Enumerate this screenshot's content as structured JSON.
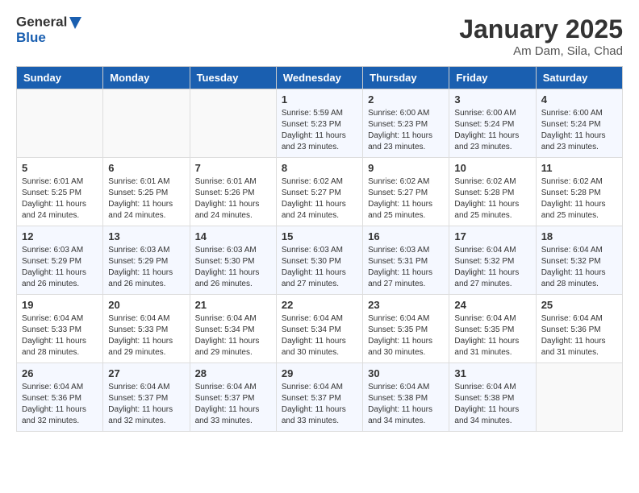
{
  "header": {
    "logo": {
      "text_general": "General",
      "text_blue": "Blue"
    },
    "title": "January 2025",
    "location": "Am Dam, Sila, Chad"
  },
  "weekdays": [
    "Sunday",
    "Monday",
    "Tuesday",
    "Wednesday",
    "Thursday",
    "Friday",
    "Saturday"
  ],
  "weeks": [
    [
      {
        "day": "",
        "info": ""
      },
      {
        "day": "",
        "info": ""
      },
      {
        "day": "",
        "info": ""
      },
      {
        "day": "1",
        "info": "Sunrise: 5:59 AM\nSunset: 5:23 PM\nDaylight: 11 hours\nand 23 minutes."
      },
      {
        "day": "2",
        "info": "Sunrise: 6:00 AM\nSunset: 5:23 PM\nDaylight: 11 hours\nand 23 minutes."
      },
      {
        "day": "3",
        "info": "Sunrise: 6:00 AM\nSunset: 5:24 PM\nDaylight: 11 hours\nand 23 minutes."
      },
      {
        "day": "4",
        "info": "Sunrise: 6:00 AM\nSunset: 5:24 PM\nDaylight: 11 hours\nand 23 minutes."
      }
    ],
    [
      {
        "day": "5",
        "info": "Sunrise: 6:01 AM\nSunset: 5:25 PM\nDaylight: 11 hours\nand 24 minutes."
      },
      {
        "day": "6",
        "info": "Sunrise: 6:01 AM\nSunset: 5:25 PM\nDaylight: 11 hours\nand 24 minutes."
      },
      {
        "day": "7",
        "info": "Sunrise: 6:01 AM\nSunset: 5:26 PM\nDaylight: 11 hours\nand 24 minutes."
      },
      {
        "day": "8",
        "info": "Sunrise: 6:02 AM\nSunset: 5:27 PM\nDaylight: 11 hours\nand 24 minutes."
      },
      {
        "day": "9",
        "info": "Sunrise: 6:02 AM\nSunset: 5:27 PM\nDaylight: 11 hours\nand 25 minutes."
      },
      {
        "day": "10",
        "info": "Sunrise: 6:02 AM\nSunset: 5:28 PM\nDaylight: 11 hours\nand 25 minutes."
      },
      {
        "day": "11",
        "info": "Sunrise: 6:02 AM\nSunset: 5:28 PM\nDaylight: 11 hours\nand 25 minutes."
      }
    ],
    [
      {
        "day": "12",
        "info": "Sunrise: 6:03 AM\nSunset: 5:29 PM\nDaylight: 11 hours\nand 26 minutes."
      },
      {
        "day": "13",
        "info": "Sunrise: 6:03 AM\nSunset: 5:29 PM\nDaylight: 11 hours\nand 26 minutes."
      },
      {
        "day": "14",
        "info": "Sunrise: 6:03 AM\nSunset: 5:30 PM\nDaylight: 11 hours\nand 26 minutes."
      },
      {
        "day": "15",
        "info": "Sunrise: 6:03 AM\nSunset: 5:30 PM\nDaylight: 11 hours\nand 27 minutes."
      },
      {
        "day": "16",
        "info": "Sunrise: 6:03 AM\nSunset: 5:31 PM\nDaylight: 11 hours\nand 27 minutes."
      },
      {
        "day": "17",
        "info": "Sunrise: 6:04 AM\nSunset: 5:32 PM\nDaylight: 11 hours\nand 27 minutes."
      },
      {
        "day": "18",
        "info": "Sunrise: 6:04 AM\nSunset: 5:32 PM\nDaylight: 11 hours\nand 28 minutes."
      }
    ],
    [
      {
        "day": "19",
        "info": "Sunrise: 6:04 AM\nSunset: 5:33 PM\nDaylight: 11 hours\nand 28 minutes."
      },
      {
        "day": "20",
        "info": "Sunrise: 6:04 AM\nSunset: 5:33 PM\nDaylight: 11 hours\nand 29 minutes."
      },
      {
        "day": "21",
        "info": "Sunrise: 6:04 AM\nSunset: 5:34 PM\nDaylight: 11 hours\nand 29 minutes."
      },
      {
        "day": "22",
        "info": "Sunrise: 6:04 AM\nSunset: 5:34 PM\nDaylight: 11 hours\nand 30 minutes."
      },
      {
        "day": "23",
        "info": "Sunrise: 6:04 AM\nSunset: 5:35 PM\nDaylight: 11 hours\nand 30 minutes."
      },
      {
        "day": "24",
        "info": "Sunrise: 6:04 AM\nSunset: 5:35 PM\nDaylight: 11 hours\nand 31 minutes."
      },
      {
        "day": "25",
        "info": "Sunrise: 6:04 AM\nSunset: 5:36 PM\nDaylight: 11 hours\nand 31 minutes."
      }
    ],
    [
      {
        "day": "26",
        "info": "Sunrise: 6:04 AM\nSunset: 5:36 PM\nDaylight: 11 hours\nand 32 minutes."
      },
      {
        "day": "27",
        "info": "Sunrise: 6:04 AM\nSunset: 5:37 PM\nDaylight: 11 hours\nand 32 minutes."
      },
      {
        "day": "28",
        "info": "Sunrise: 6:04 AM\nSunset: 5:37 PM\nDaylight: 11 hours\nand 33 minutes."
      },
      {
        "day": "29",
        "info": "Sunrise: 6:04 AM\nSunset: 5:37 PM\nDaylight: 11 hours\nand 33 minutes."
      },
      {
        "day": "30",
        "info": "Sunrise: 6:04 AM\nSunset: 5:38 PM\nDaylight: 11 hours\nand 34 minutes."
      },
      {
        "day": "31",
        "info": "Sunrise: 6:04 AM\nSunset: 5:38 PM\nDaylight: 11 hours\nand 34 minutes."
      },
      {
        "day": "",
        "info": ""
      }
    ]
  ]
}
